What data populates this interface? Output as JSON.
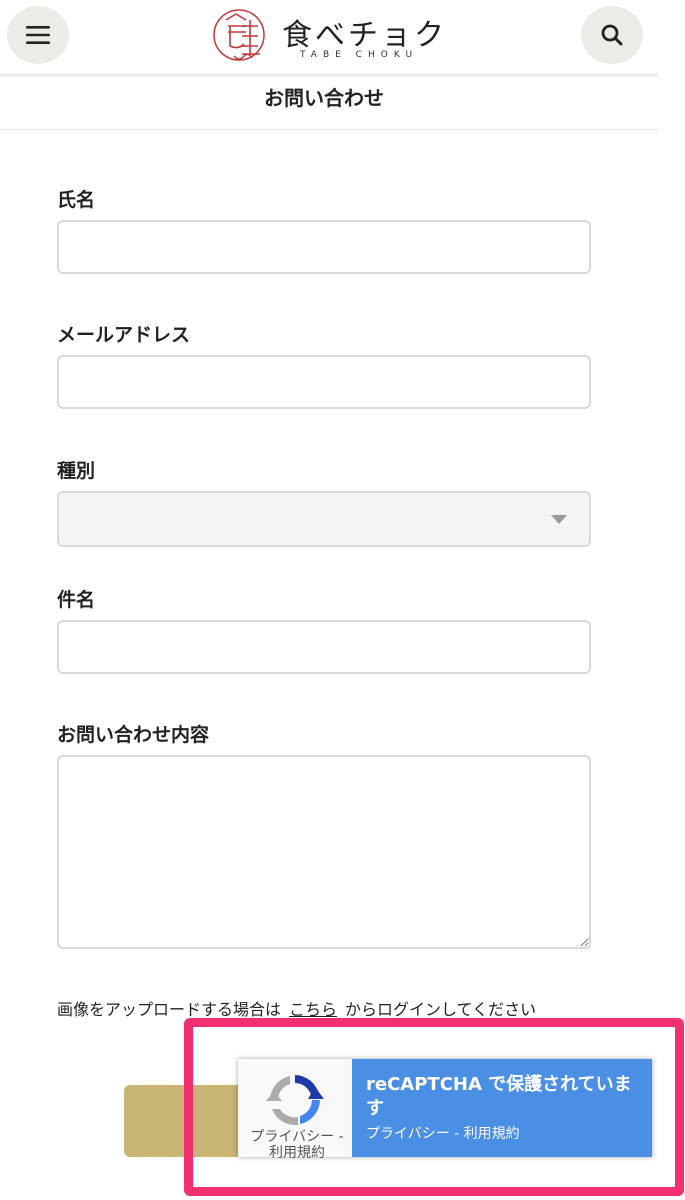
{
  "header": {
    "logo_text": "食べチョク",
    "logo_sub": "TABE CHOKU",
    "menu_icon": "hamburger-menu-icon",
    "search_icon": "search-icon"
  },
  "page": {
    "title": "お問い合わせ"
  },
  "form": {
    "name_label": "氏名",
    "name_value": "",
    "email_label": "メールアドレス",
    "email_value": "",
    "type_label": "種別",
    "type_value": "",
    "subject_label": "件名",
    "subject_value": "",
    "content_label": "お問い合わせ内容",
    "content_value": ""
  },
  "upload": {
    "prefix": "画像をアップロードする場合は",
    "link": "こちら",
    "suffix": "からログインしてください"
  },
  "recaptcha": {
    "title": "reCAPTCHA で保護されています",
    "links": "プライバシー - 利用規約",
    "small_privacy": "プライバシー - 利用規約"
  },
  "colors": {
    "submit": "#c8b474",
    "recaptcha_blue": "#4a8fe4",
    "highlight": "#f1316f",
    "logo_red": "#c0393b"
  }
}
